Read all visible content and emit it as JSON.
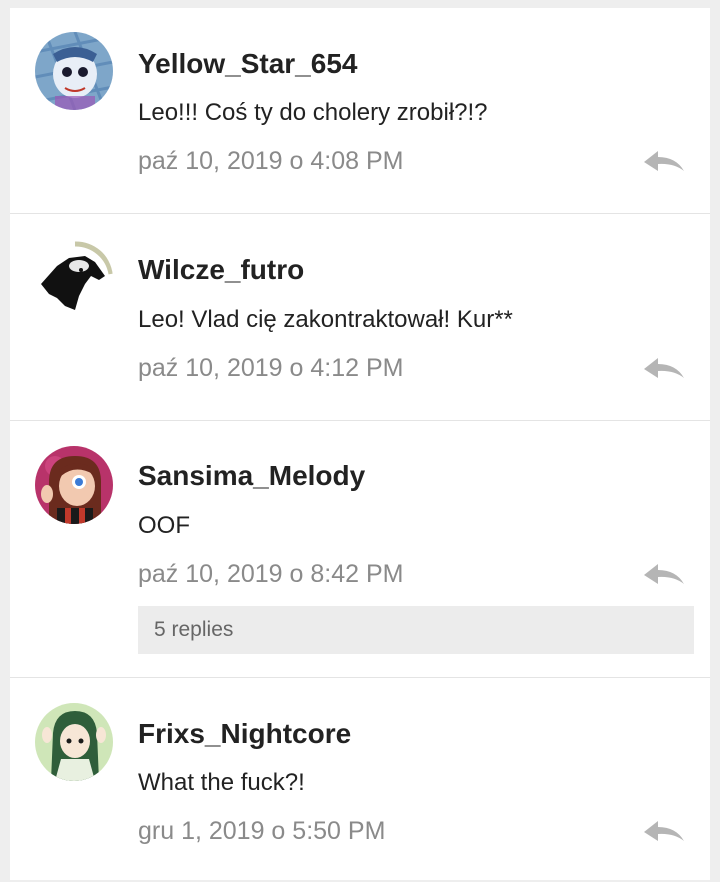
{
  "comments": [
    {
      "username": "Yellow_Star_654",
      "text": "Leo!!! Coś ty do cholery zrobił?!?",
      "date": "paź 10, 2019 o 4:08 PM",
      "avatar_icon": "avatar-drawing-icon"
    },
    {
      "username": "Wilcze_futro",
      "text": "Leo! Vlad cię zakontraktował! Kur**",
      "date": "paź 10, 2019 o 4:12 PM",
      "avatar_icon": "wolf-avatar-icon"
    },
    {
      "username": "Sansima_Melody",
      "text": "OOF",
      "date": "paź 10, 2019 o 8:42 PM",
      "avatar_icon": "girl-avatar-icon",
      "replies_label": "5 replies"
    },
    {
      "username": "Frixs_Nightcore",
      "text": "What the fuck?!",
      "date": "gru 1, 2019 o 5:50 PM",
      "avatar_icon": "anime-avatar-icon"
    }
  ],
  "colors": {
    "background": "#eeeeee",
    "card": "#ffffff",
    "username": "#222222",
    "date": "#8a8a8a",
    "replies_bg": "#ececec",
    "reply_icon": "#b5b5b5"
  }
}
